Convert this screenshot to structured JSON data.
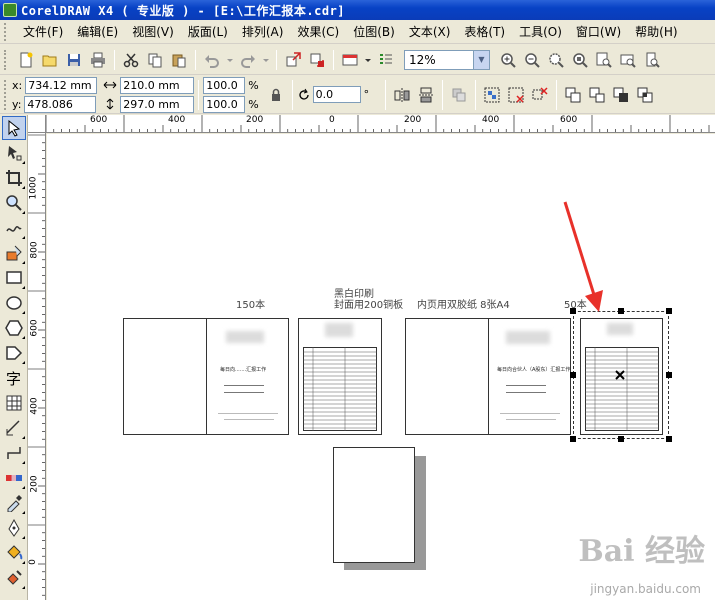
{
  "window": {
    "title": "CorelDRAW X4 ( 专业版 ) - [E:\\工作汇报本.cdr]"
  },
  "menu": {
    "items": [
      "文件(F)",
      "编辑(E)",
      "视图(V)",
      "版面(L)",
      "排列(A)",
      "效果(C)",
      "位图(B)",
      "文本(X)",
      "表格(T)",
      "工具(O)",
      "窗口(W)",
      "帮助(H)"
    ]
  },
  "toolbar": {
    "zoom": "12%"
  },
  "propertybar": {
    "x_label": "x:",
    "y_label": "y:",
    "x_value": "734.12 mm",
    "y_value": "478.086 mm",
    "w_value": "210.0 mm",
    "h_value": "297.0 mm",
    "scale_w": "100.0",
    "scale_h": "100.0",
    "pct": "%",
    "rotation": "0.0",
    "degree": "°"
  },
  "rulers": {
    "h_ticks": [
      "600",
      "400",
      "200",
      "0",
      "200",
      "400",
      "600"
    ],
    "v_ticks": [
      "1000",
      "800",
      "600",
      "400",
      "200",
      "0"
    ]
  },
  "canvas": {
    "label_150": "150本",
    "label_heibai": "黑白印刷",
    "label_cover": "封面用200铜板",
    "label_inner": "内页用双胶纸 8张A4",
    "label_50": "50本",
    "page1_title": "每日向.......汇报工作",
    "page3_title": "每日向合伙人（A股东）汇报工作",
    "watermark": "Bai 经验",
    "watermark_url": "jingyan.baidu.com"
  },
  "colors": {
    "arrow": "#e8312a",
    "selection": "#000000",
    "title_bar": "#0842c5"
  }
}
